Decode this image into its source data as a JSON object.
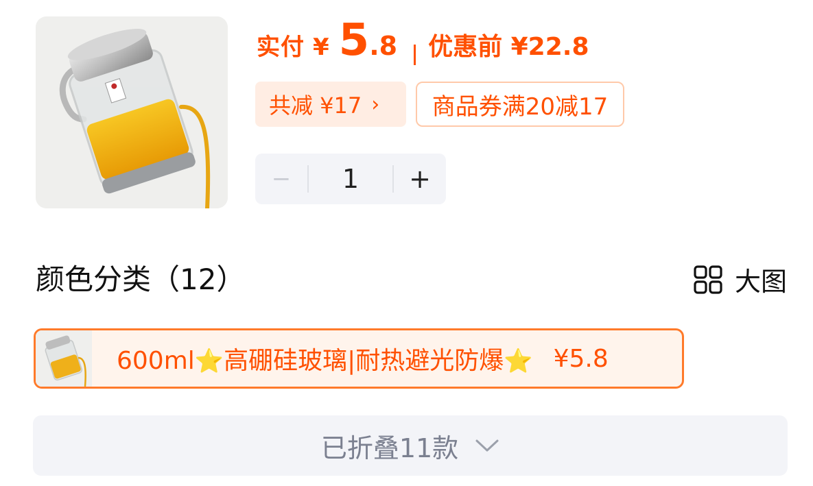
{
  "product": {
    "image_icon": "oil-dispenser-bottle-image"
  },
  "price": {
    "paid_label": "实付",
    "currency": "¥",
    "paid_integer": "5",
    "paid_decimal": ".8",
    "original_label": "优惠前 ¥22.8"
  },
  "discounts": {
    "total_label": "共减 ¥17",
    "total_chevron": "›",
    "coupon_label": "商品券满20减17"
  },
  "stepper": {
    "minus": "−",
    "quantity": "1",
    "plus": "+"
  },
  "section": {
    "title": "颜色分类（12）",
    "big_view_label": "大图",
    "big_view_icon": "grid-icon"
  },
  "selected_sku": {
    "text_before_star": "600ml",
    "star1": "⭐",
    "text_middle": "高硼硅玻璃|耐热避光防爆",
    "star2": "⭐",
    "price": "¥5.8"
  },
  "folded": {
    "label": "已折叠11款",
    "icon": "chevron-down-icon"
  },
  "colors": {
    "accent": "#ff5000",
    "tag_bg": "#ffede3",
    "panel_bg": "#f3f4f8",
    "star": "#ffc21a"
  }
}
